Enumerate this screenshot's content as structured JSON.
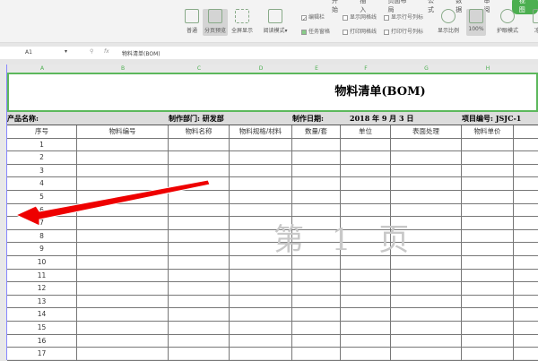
{
  "menu_tabs": [
    "开始",
    "插入",
    "页面布局",
    "公式",
    "数据",
    "审阅",
    "视图"
  ],
  "toolbar": {
    "normal": "普通",
    "page_break_preview": "分页预览",
    "fullscreen": "全屏显示",
    "reading_mode": "阅读模式",
    "edit_bar": "编辑栏",
    "task_pane": "任务窗格",
    "show_gridlines": "显示网格线",
    "show_headers": "显示行号列标",
    "print_gridlines": "打印网格线",
    "print_headers": "打印行号列标",
    "zoom": "显示比例",
    "zoom_100": "100%",
    "eye_mode": "护眼模式",
    "freeze": "冻结"
  },
  "formula_bar": {
    "cell_ref": "A1",
    "fx": "fx",
    "content": "物料清单(BOM)"
  },
  "columns": [
    "A",
    "B",
    "C",
    "D",
    "E",
    "F",
    "G",
    "H"
  ],
  "sheet": {
    "title": "物料清单(BOM)",
    "product_name": "产品名称:",
    "department": "制作部门: 研发部",
    "date_label": "制作日期:",
    "date_value": "2018 年  9 月  3 日",
    "project_no": "项目编号: JSJC-1",
    "headers": [
      "序号",
      "物料编号",
      "物料名称",
      "物料规格/材料",
      "数量/套",
      "单位",
      "表面处理",
      "物料单价",
      ""
    ],
    "rows": [
      "1",
      "2",
      "3",
      "4",
      "5",
      "6",
      "7",
      "8",
      "9",
      "10",
      "11",
      "12",
      "13",
      "14",
      "15",
      "16",
      "17"
    ]
  },
  "watermark": "第 1 页",
  "arrow_color": "#ff0000"
}
